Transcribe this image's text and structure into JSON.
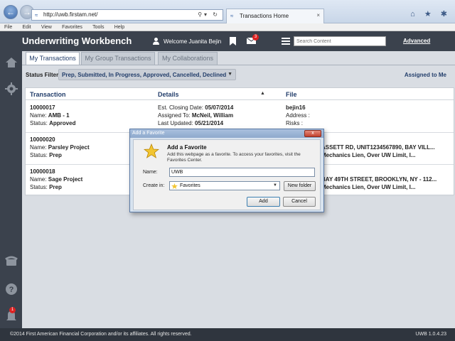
{
  "browser": {
    "url": "http://uwb.firstam.net/",
    "tab_title": "Transactions Home",
    "tab_close": "×",
    "chrome_icons": "⌂ ★ ✱"
  },
  "menubar": [
    "File",
    "Edit",
    "View",
    "Favorites",
    "Tools",
    "Help"
  ],
  "header": {
    "title": "Underwriting Workbench",
    "welcome": "Welcome Juanita Bejin",
    "mail_badge": "3",
    "search_placeholder": "Search Content",
    "advanced": "Advanced"
  },
  "sidebar": {
    "icons": [
      "home-icon",
      "gear-icon",
      "phone-icon",
      "help-icon",
      "bell-icon"
    ],
    "bell_badge": "1"
  },
  "tabs": [
    "My Transactions",
    "My Group Transactions",
    "My Collaborations"
  ],
  "filter": {
    "label": "Status Filter:",
    "value": "Prep, Submitted, In Progress, Approved, Cancelled, Declined",
    "assigned": "Assigned to Me"
  },
  "table": {
    "headers": {
      "transaction": "Transaction",
      "details": "Details",
      "file": "File"
    },
    "rows": [
      {
        "id": "10000017",
        "name_label": "Name: ",
        "name": "AMB - 1",
        "status_label": "Status: ",
        "status": "Approved",
        "d1_label": "Est. Closing Date: ",
        "d1": "05/07/2014",
        "d2_label": "Assigned To: ",
        "d2": "McNeil, William",
        "d3_label": "Last Updated: ",
        "d3": "05/21/2014",
        "file1": "bejin16",
        "file2": "Address :",
        "file3": "Risks :"
      },
      {
        "id": "10000020",
        "name_label": "Name: ",
        "name": "Parsley Project",
        "status_label": "Status: ",
        "status": "Prep",
        "file2": "ASSETT RD, UNIT1234567890, BAY VILL...",
        "file3": "Mechanics Lien, Over UW Limit, I..."
      },
      {
        "id": "10000018",
        "name_label": "Name: ",
        "name": "Sage Project",
        "status_label": "Status: ",
        "status": "Prep",
        "file2": "BAY 49TH STREET, BROOKLYN, NY - 112...",
        "file3": "Mechanics Lien, Over UW Limit, I..."
      }
    ]
  },
  "footer": {
    "copyright": "©2014 First American Financial Corporation and/or its affiliates. All rights reserved.",
    "version": "UWB 1.0.4.23"
  },
  "dialog": {
    "title": "Add a Favorite",
    "close": "x",
    "heading": "Add a Favorite",
    "description": "Add this webpage as a favorite. To access your favorites, visit the Favorites Center.",
    "name_label": "Name:",
    "name_value": "UWB",
    "createin_label": "Create in:",
    "createin_value": "Favorites",
    "new_folder": "New folder",
    "add": "Add",
    "cancel": "Cancel"
  },
  "colors": {
    "header_bg": "#3b424d",
    "accent_text": "#233e6b",
    "badge_red": "#dd2222"
  }
}
